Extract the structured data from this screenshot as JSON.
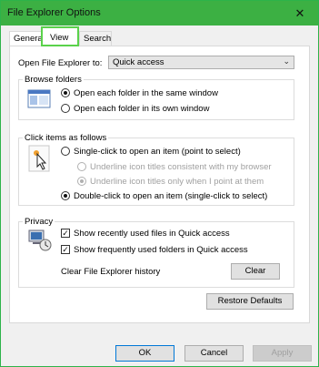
{
  "window": {
    "title": "File Explorer Options",
    "close_glyph": "✕"
  },
  "tabs": [
    {
      "label": "General"
    },
    {
      "label": "View"
    },
    {
      "label": "Search"
    }
  ],
  "open_to": {
    "label": "Open File Explorer to:",
    "value": "Quick access"
  },
  "browse": {
    "title": "Browse folders",
    "options": [
      {
        "label": "Open each folder in the same window",
        "checked": true
      },
      {
        "label": "Open each folder in its own window",
        "checked": false
      }
    ]
  },
  "click": {
    "title": "Click items as follows",
    "options": [
      {
        "label": "Single-click to open an item (point to select)",
        "checked": false
      },
      {
        "label": "Underline icon titles consistent with my browser",
        "checked": false,
        "disabled": true
      },
      {
        "label": "Underline icon titles only when I point at them",
        "checked": true,
        "disabled": true
      },
      {
        "label": "Double-click to open an item (single-click to select)",
        "checked": true
      }
    ]
  },
  "privacy": {
    "title": "Privacy",
    "checks": [
      {
        "label": "Show recently used files in Quick access",
        "checked": true
      },
      {
        "label": "Show frequently used folders in Quick access",
        "checked": true
      }
    ],
    "clear_label": "Clear File Explorer history",
    "clear_button": "Clear"
  },
  "restore_button": "Restore Defaults",
  "footer": {
    "ok": "OK",
    "cancel": "Cancel",
    "apply": "Apply"
  },
  "colors": {
    "titlebar": "#3cb043",
    "highlight_border": "#5ad24b"
  }
}
